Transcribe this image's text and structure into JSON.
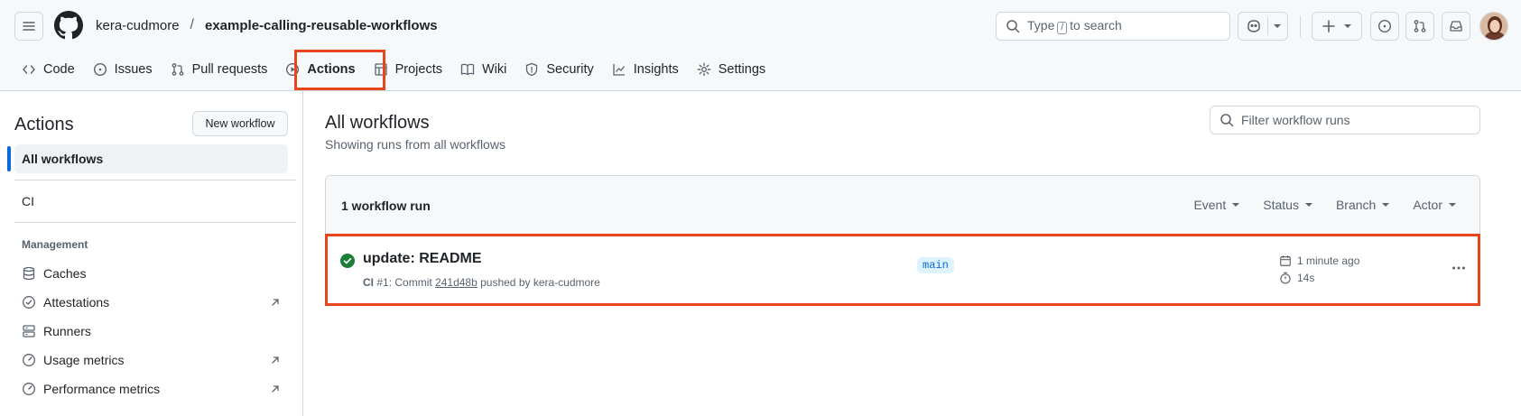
{
  "header": {
    "owner": "kera-cudmore",
    "separator": "/",
    "repo": "example-calling-reusable-workflows",
    "search_prefix": "Type",
    "search_key": "/",
    "search_suffix": "to search"
  },
  "tabs": [
    {
      "label": "Code",
      "icon": "code-icon"
    },
    {
      "label": "Issues",
      "icon": "issue-icon"
    },
    {
      "label": "Pull requests",
      "icon": "pull-request-icon"
    },
    {
      "label": "Actions",
      "icon": "play-icon",
      "active": true
    },
    {
      "label": "Projects",
      "icon": "table-icon"
    },
    {
      "label": "Wiki",
      "icon": "book-icon"
    },
    {
      "label": "Security",
      "icon": "shield-icon"
    },
    {
      "label": "Insights",
      "icon": "graph-icon"
    },
    {
      "label": "Settings",
      "icon": "gear-icon"
    }
  ],
  "sidebar": {
    "title": "Actions",
    "new_workflow": "New workflow",
    "all_workflows": "All workflows",
    "workflows": [
      "CI"
    ],
    "management_heading": "Management",
    "management": [
      {
        "label": "Caches",
        "icon": "database-icon",
        "external": false
      },
      {
        "label": "Attestations",
        "icon": "verified-icon",
        "external": true
      },
      {
        "label": "Runners",
        "icon": "server-icon",
        "external": false
      },
      {
        "label": "Usage metrics",
        "icon": "meter-icon",
        "external": true
      },
      {
        "label": "Performance metrics",
        "icon": "meter-icon",
        "external": true
      }
    ]
  },
  "main": {
    "title": "All workflows",
    "subtitle": "Showing runs from all workflows",
    "filter_placeholder": "Filter workflow runs",
    "run_count": "1 workflow run",
    "filters": [
      "Event",
      "Status",
      "Branch",
      "Actor"
    ],
    "run": {
      "title": "update: README",
      "workflow": "CI",
      "number": "#1",
      "commit_prefix": ": Commit",
      "sha": "241d48b",
      "pushed_by": "pushed by kera-cudmore",
      "branch": "main",
      "time_ago": "1 minute ago",
      "duration": "14s",
      "status": "success"
    }
  },
  "colors": {
    "accent": "#0969da",
    "success": "#1a7f37",
    "highlight": "#e8441e"
  }
}
